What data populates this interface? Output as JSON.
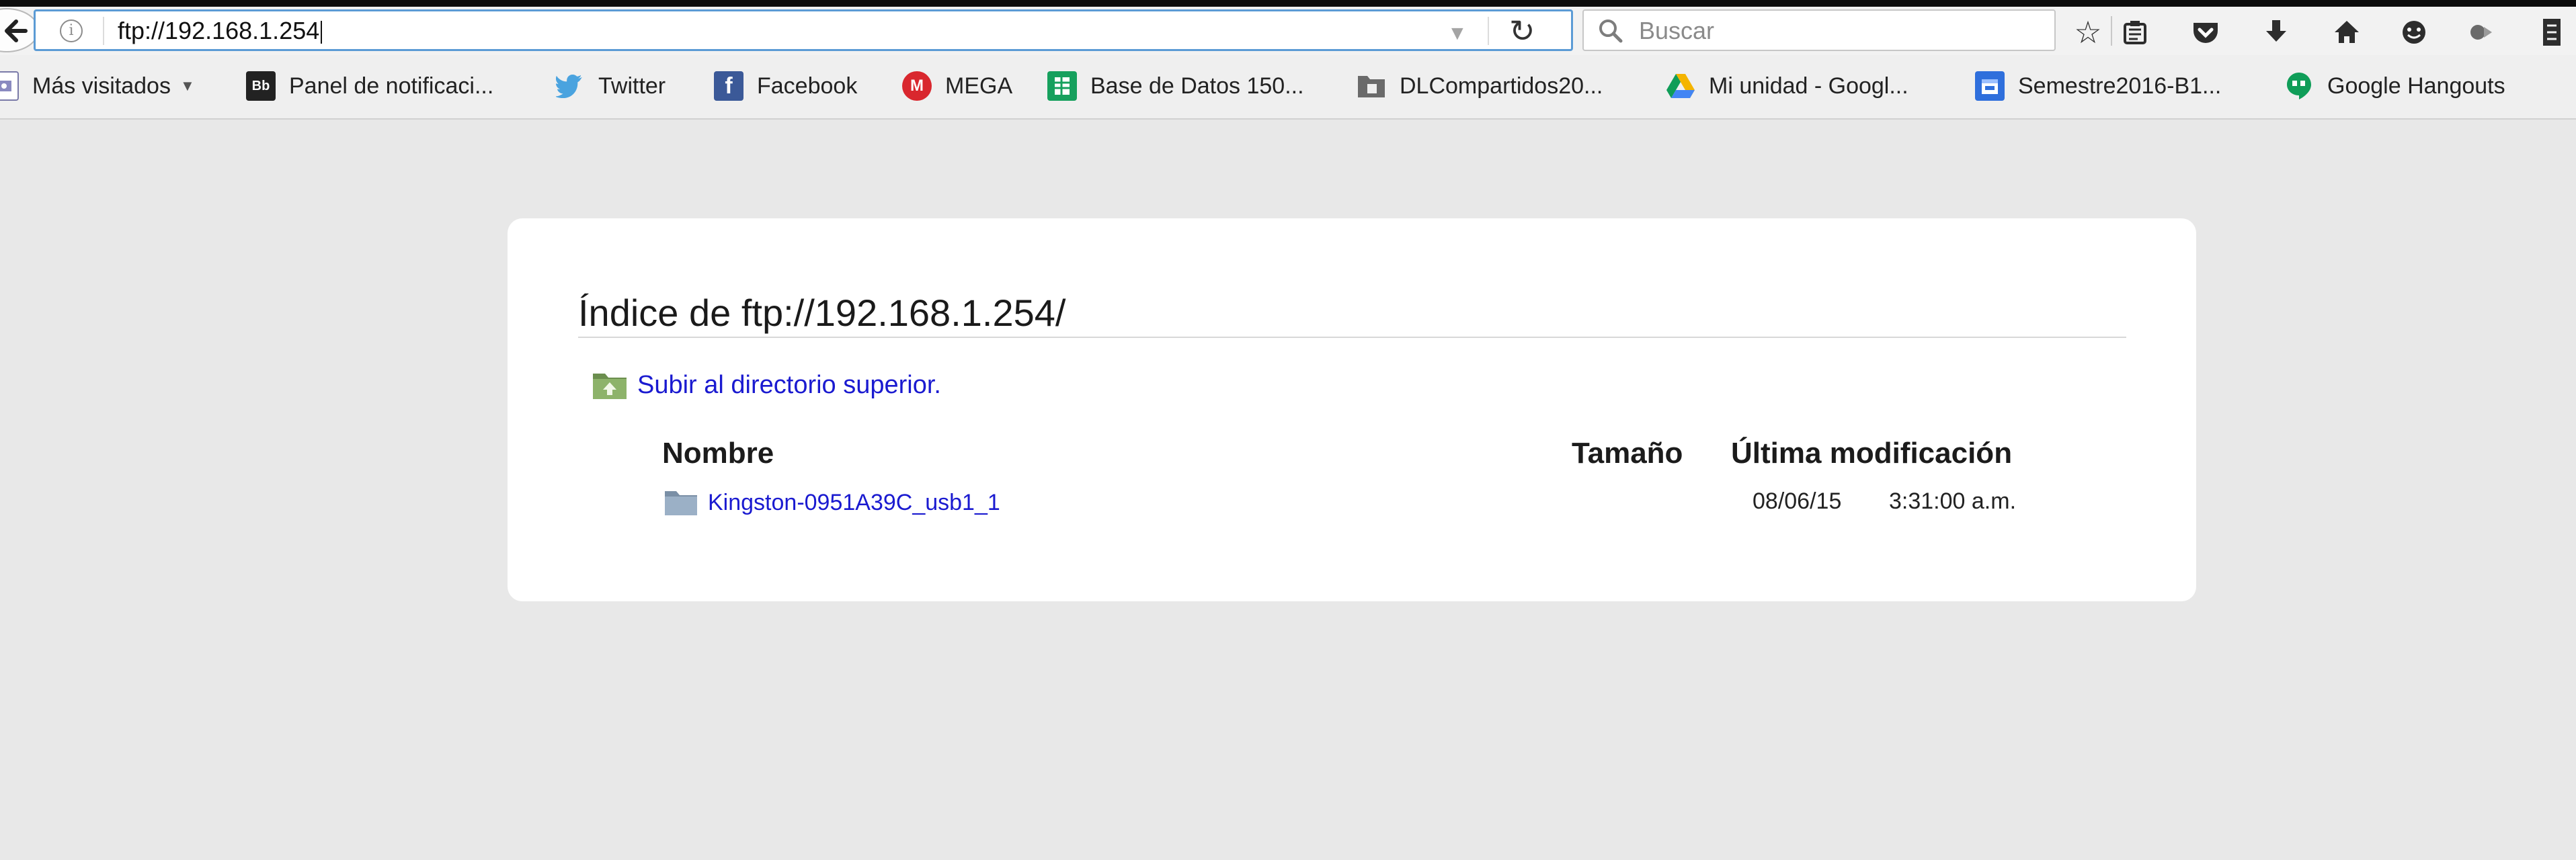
{
  "navbar": {
    "url": "ftp://192.168.1.254",
    "search_placeholder": "Buscar"
  },
  "bookmarks": [
    {
      "label": "Más visitados",
      "icon": "most-visited-icon"
    },
    {
      "label": "Panel de notificaci...",
      "icon": "blackboard-icon",
      "icon_text": "Bb"
    },
    {
      "label": "Twitter",
      "icon": "twitter-icon"
    },
    {
      "label": "Facebook",
      "icon": "facebook-icon",
      "icon_text": "f"
    },
    {
      "label": "MEGA",
      "icon": "mega-icon",
      "icon_text": "M"
    },
    {
      "label": "Base de Datos 150...",
      "icon": "sheets-icon"
    },
    {
      "label": "DLCompartidos20...",
      "icon": "folder-icon"
    },
    {
      "label": "Mi unidad - Googl...",
      "icon": "drive-icon"
    },
    {
      "label": "Semestre2016-B1...",
      "icon": "calendar-icon"
    },
    {
      "label": "Google Hangouts",
      "icon": "hangouts-icon"
    }
  ],
  "listing": {
    "title": "Índice de ftp://192.168.1.254/",
    "parent_link": "Subir al directorio superior.",
    "columns": {
      "name": "Nombre",
      "size": "Tamaño",
      "modified": "Última modificación"
    },
    "rows": [
      {
        "name": "Kingston-0951A39C_usb1_1",
        "size": "",
        "date": "08/06/15",
        "time": "3:31:00 a.m."
      }
    ]
  },
  "colors": {
    "link": "#1a1ad0",
    "urlbar_focus": "#5b9bd5",
    "page_background": "#e8e8e8"
  }
}
